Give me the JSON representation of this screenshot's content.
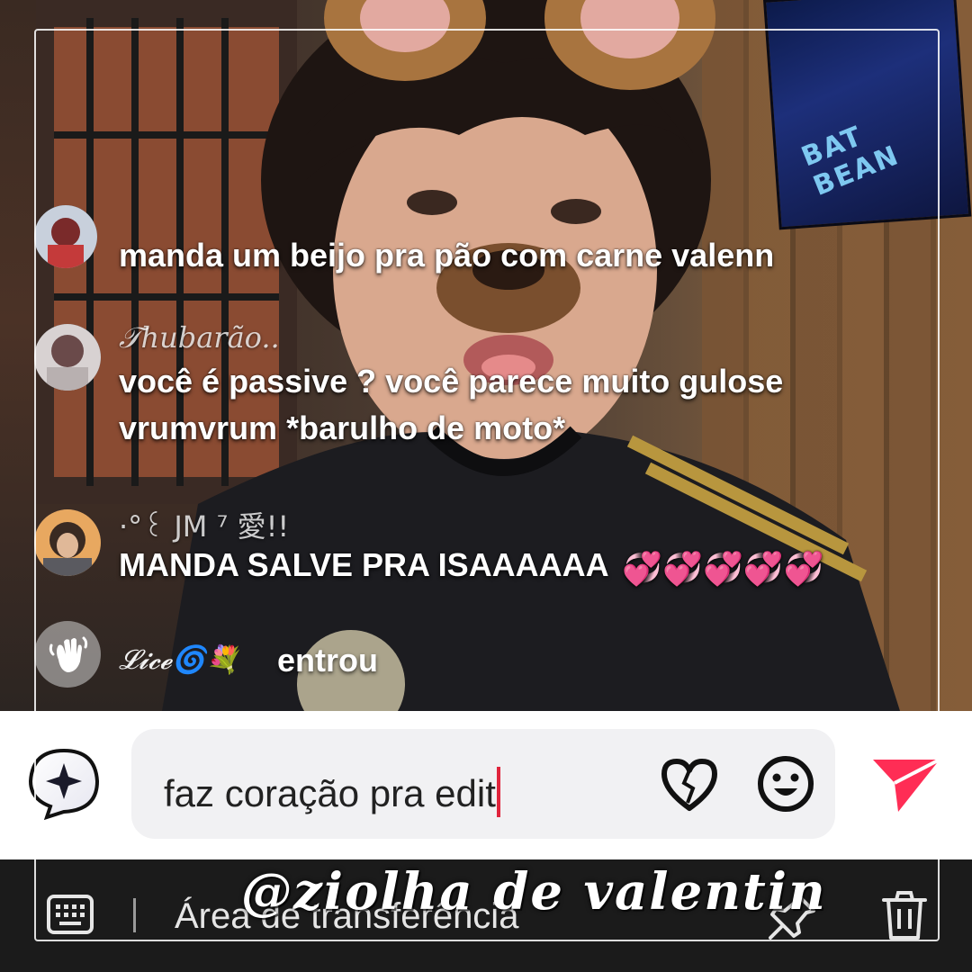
{
  "chat": {
    "comments": [
      {
        "username": "",
        "message": "manda um beijo pra pão com carne valenn"
      },
      {
        "username": "𝒯hubarão..",
        "message": "você é passive ? você parece muito gulose",
        "message_line2": "vrumvrum *barulho de moto*"
      },
      {
        "username": "·°꒰ JM ⁷ 愛!!",
        "message": "MANDA SALVE PRA ISAAAAAA",
        "emoji": "💞💞💞💞💞"
      }
    ],
    "join_event": {
      "username": "𝓛𝓲𝓬𝓮🌀💐",
      "action": "entrou"
    }
  },
  "input": {
    "value": "faz coração pra edit",
    "icons": {
      "ai": "sparkle-chat-icon",
      "heart": "heart-icon",
      "emoji": "smiley-icon",
      "send": "send-icon"
    },
    "accent_color": "#ff2d55"
  },
  "keyboard_bar": {
    "label": "Área de transferência",
    "icons": {
      "keyboard": "keyboard-icon",
      "pin": "pin-icon",
      "delete": "trash-icon"
    }
  },
  "overlay": {
    "watermark": "@ziolha de valentin"
  }
}
